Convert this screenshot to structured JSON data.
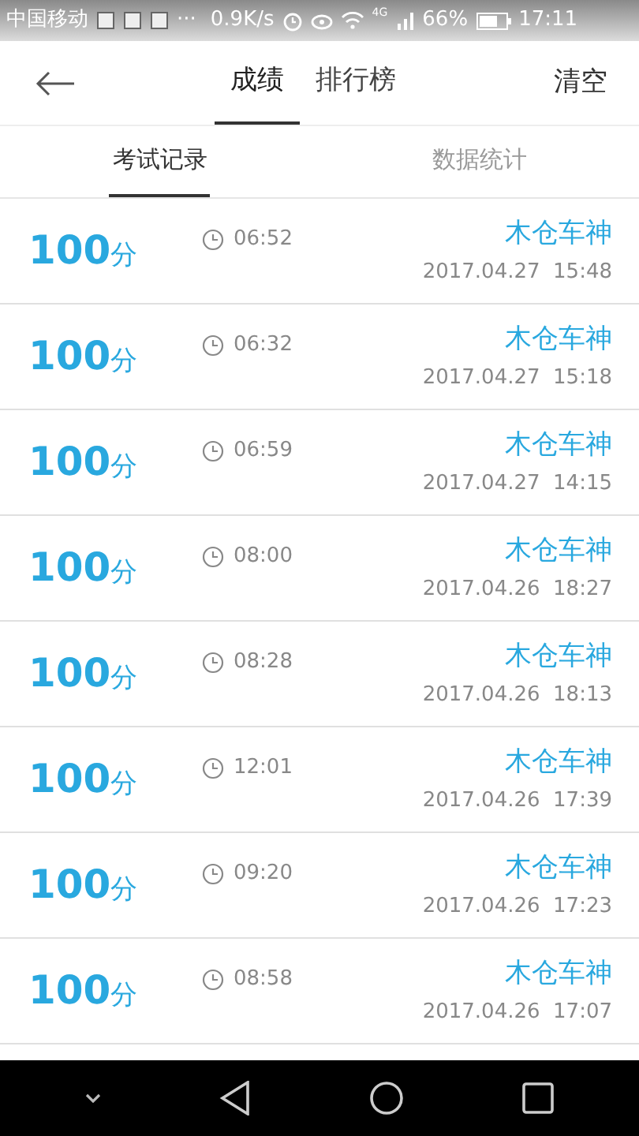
{
  "status_bar": {
    "carrier": "中国移动",
    "more": "···",
    "speed": "0.9K/s",
    "network": "4G",
    "battery": "66%",
    "time": "17:11"
  },
  "header": {
    "tabs": [
      {
        "label": "成绩",
        "selected": true
      },
      {
        "label": "排行榜",
        "selected": false
      }
    ],
    "action": "清空"
  },
  "sub_tabs": [
    {
      "label": "考试记录",
      "selected": true
    },
    {
      "label": "数据统计",
      "selected": false
    }
  ],
  "records": [
    {
      "score": "100",
      "unit": "分",
      "duration": "06:52",
      "name": "木仓车神",
      "date": "2017.04.27",
      "time": "15:48"
    },
    {
      "score": "100",
      "unit": "分",
      "duration": "06:32",
      "name": "木仓车神",
      "date": "2017.04.27",
      "time": "15:18"
    },
    {
      "score": "100",
      "unit": "分",
      "duration": "06:59",
      "name": "木仓车神",
      "date": "2017.04.27",
      "time": "14:15"
    },
    {
      "score": "100",
      "unit": "分",
      "duration": "08:00",
      "name": "木仓车神",
      "date": "2017.04.26",
      "time": "18:27"
    },
    {
      "score": "100",
      "unit": "分",
      "duration": "08:28",
      "name": "木仓车神",
      "date": "2017.04.26",
      "time": "18:13"
    },
    {
      "score": "100",
      "unit": "分",
      "duration": "12:01",
      "name": "木仓车神",
      "date": "2017.04.26",
      "time": "17:39"
    },
    {
      "score": "100",
      "unit": "分",
      "duration": "09:20",
      "name": "木仓车神",
      "date": "2017.04.26",
      "time": "17:23"
    },
    {
      "score": "100",
      "unit": "分",
      "duration": "08:58",
      "name": "木仓车神",
      "date": "2017.04.26",
      "time": "17:07"
    }
  ]
}
